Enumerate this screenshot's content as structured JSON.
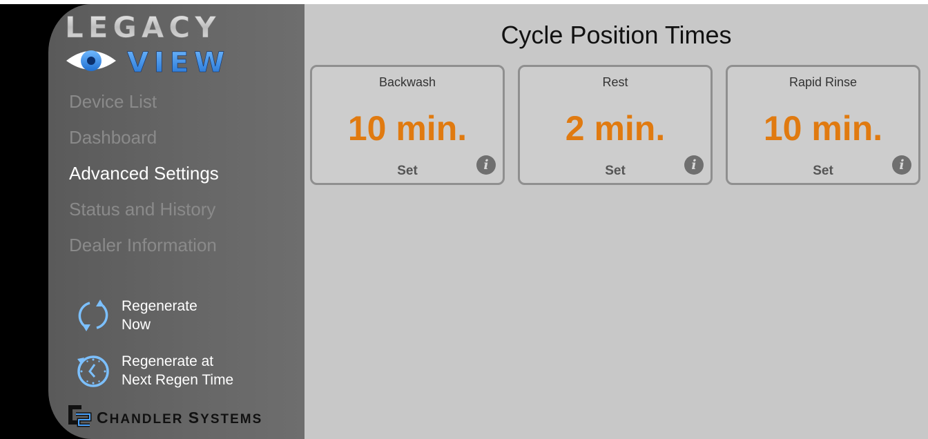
{
  "logo": {
    "line1": "LEGACY",
    "line2": "VIEW"
  },
  "nav": {
    "items": [
      {
        "label": "Device List"
      },
      {
        "label": "Dashboard"
      },
      {
        "label": "Advanced Settings"
      },
      {
        "label": "Status and History"
      },
      {
        "label": "Dealer Information"
      }
    ],
    "active_index": 2
  },
  "actions": {
    "regen_now": {
      "line1": "Regenerate",
      "line2": "Now"
    },
    "regen_next": {
      "line1": "Regenerate at",
      "line2": "Next Regen Time"
    }
  },
  "brand": {
    "name_first": "C",
    "name_first_rest": "HANDLER",
    "name_second": "S",
    "name_second_rest": "YSTEMS"
  },
  "page": {
    "title": "Cycle Position Times"
  },
  "cards": [
    {
      "label": "Backwash",
      "value": "10 min.",
      "set_label": "Set",
      "info_glyph": "i"
    },
    {
      "label": "Rest",
      "value": "2 min.",
      "set_label": "Set",
      "info_glyph": "i"
    },
    {
      "label": "Rapid Rinse",
      "value": "10 min.",
      "set_label": "Set",
      "info_glyph": "i"
    }
  ],
  "colors": {
    "accent_value": "#e07a10",
    "nav_active": "#ffffff",
    "nav_inactive": "#8a8a8a",
    "icon_blue": "#4aa3ff"
  }
}
